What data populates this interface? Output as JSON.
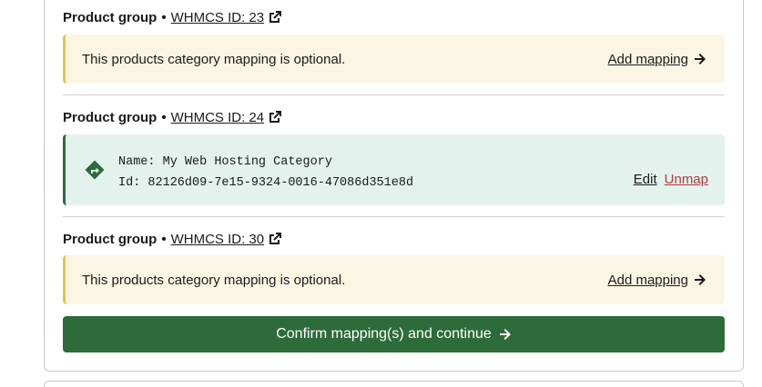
{
  "groups": [
    {
      "label": "Product group",
      "separator": "•",
      "id_link": "WHMCS ID: 23",
      "notice_text": "This products category mapping is optional.",
      "action_label": "Add mapping"
    },
    {
      "label": "Product group",
      "separator": "•",
      "id_link": "WHMCS ID: 24",
      "mapping": {
        "name_line": "Name: My Web Hosting Category",
        "id_line": "Id: 82126d09-7e15-9324-0016-47086d351e8d",
        "edit_label": "Edit",
        "unmap_label": "Unmap"
      }
    },
    {
      "label": "Product group",
      "separator": "•",
      "id_link": "WHMCS ID: 30",
      "notice_text": "This products category mapping is optional.",
      "action_label": "Add mapping"
    }
  ],
  "confirm_label": "Confirm mapping(s) and continue",
  "icons": {
    "external": "external-link-icon",
    "arrow": "arrow-right-icon",
    "route": "route-diamond-icon"
  },
  "colors": {
    "notice_bg": "#faf6e3",
    "notice_border": "#e3c64a",
    "mapped_bg": "#e3f2ec",
    "mapped_border": "#2c6b3b",
    "primary": "#2d6b3a",
    "danger": "#b23a3a"
  }
}
